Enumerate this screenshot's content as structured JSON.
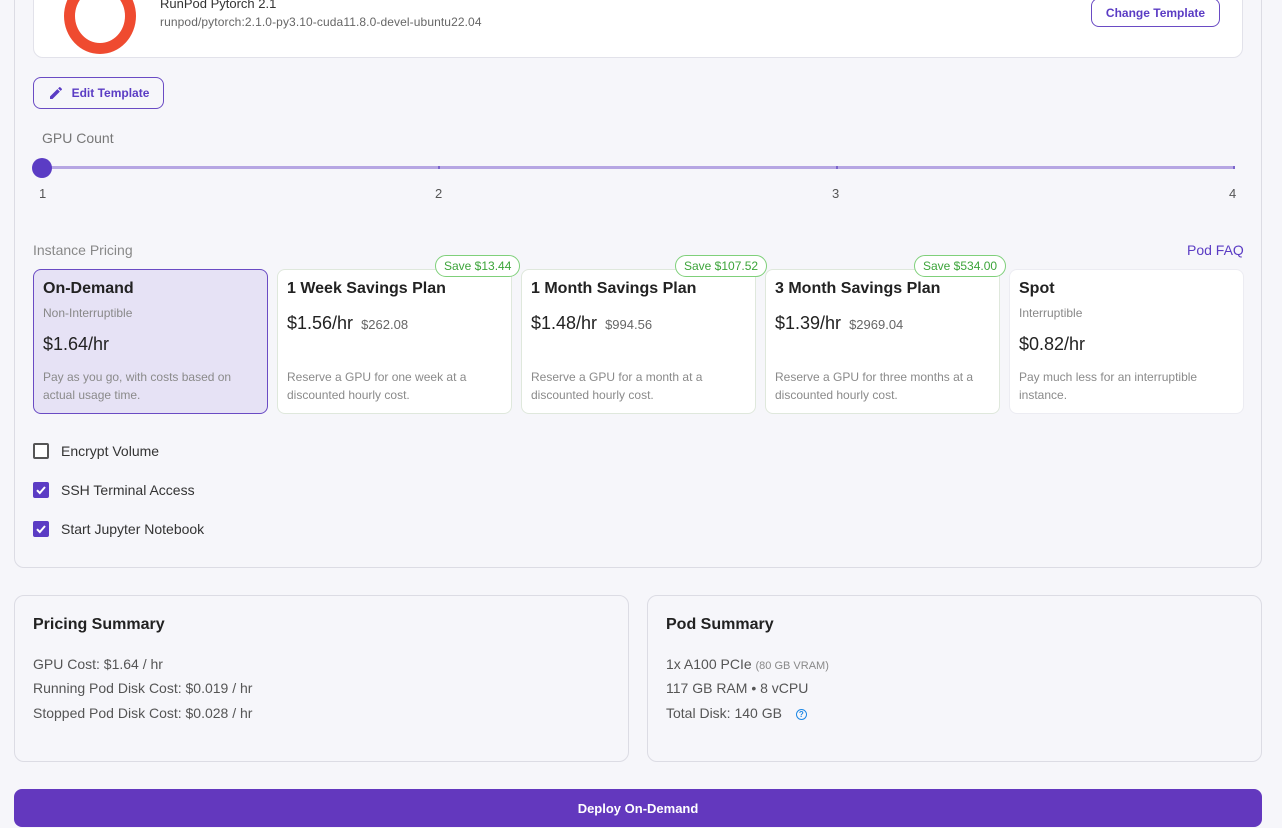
{
  "template": {
    "name": "RunPod Pytorch 2.1",
    "image": "runpod/pytorch:2.1.0-py3.10-cuda11.8.0-devel-ubuntu22.04",
    "change_label": "Change Template",
    "edit_label": "Edit Template"
  },
  "gpu_count": {
    "label": "GPU Count",
    "value": 1,
    "min": 1,
    "max": 4,
    "marks": [
      "1",
      "2",
      "3",
      "4"
    ]
  },
  "pricing": {
    "section_label": "Instance Pricing",
    "faq_label": "Pod FAQ",
    "plans": [
      {
        "title": "On-Demand",
        "subtitle": "Non-Interruptible",
        "price": "$1.64/hr",
        "desc": "Pay as you go, with costs based on actual usage time.",
        "selected": true
      },
      {
        "title": "1 Week Savings Plan",
        "price": "$1.56/hr",
        "total": "$262.08",
        "badge": "Save $13.44",
        "desc": "Reserve a GPU for one week at a discounted hourly cost."
      },
      {
        "title": "1 Month Savings Plan",
        "price": "$1.48/hr",
        "total": "$994.56",
        "badge": "Save $107.52",
        "desc": "Reserve a GPU for a month at a discounted hourly cost."
      },
      {
        "title": "3 Month Savings Plan",
        "price": "$1.39/hr",
        "total": "$2969.04",
        "badge": "Save $534.00",
        "desc": "Reserve a GPU for three months at a discounted hourly cost."
      },
      {
        "title": "Spot",
        "subtitle": "Interruptible",
        "price": "$0.82/hr",
        "desc": "Pay much less for an interruptible instance."
      }
    ]
  },
  "options": [
    {
      "label": "Encrypt Volume",
      "checked": false
    },
    {
      "label": "SSH Terminal Access",
      "checked": true
    },
    {
      "label": "Start Jupyter Notebook",
      "checked": true
    }
  ],
  "pricing_summary": {
    "title": "Pricing Summary",
    "gpu_cost": "GPU Cost: $1.64 / hr",
    "running_disk": "Running Pod Disk Cost: $0.019 / hr",
    "stopped_disk": "Stopped Pod Disk Cost: $0.028 / hr"
  },
  "pod_summary": {
    "title": "Pod Summary",
    "gpu": "1x A100 PCIe",
    "vram": "(80 GB VRAM)",
    "ram_cpu": "117 GB RAM • 8 vCPU",
    "disk": "Total Disk: 140 GB",
    "help_icon": "question-circle-icon"
  },
  "deploy_label": "Deploy On-Demand",
  "colors": {
    "accent": "#6338be",
    "save_green": "#3ca43a",
    "logo": "#ef4b30"
  }
}
